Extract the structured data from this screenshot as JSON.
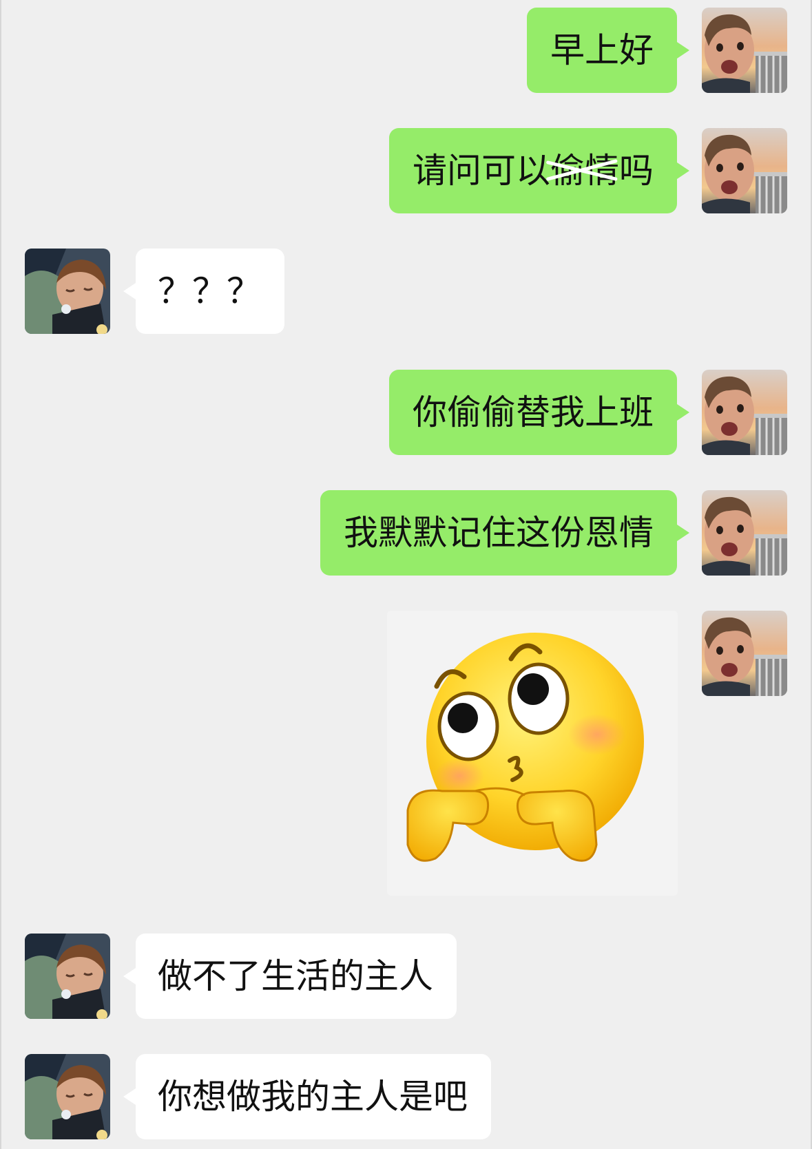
{
  "messages": [
    {
      "side": "right",
      "text": "早上好"
    },
    {
      "side": "right",
      "text": "请问可以偷情吗"
    },
    {
      "side": "left",
      "text": "？？？"
    },
    {
      "side": "right",
      "text": "你偷偷替我上班"
    },
    {
      "side": "right",
      "text": "我默默记住这份恩情"
    },
    {
      "side": "right",
      "type": "sticker",
      "sticker": "blushing-emoji-sticker"
    },
    {
      "side": "left",
      "text": "做不了生活的主人"
    },
    {
      "side": "left",
      "text": "你想做我的主人是吧"
    }
  ],
  "colors": {
    "background": "#efefef",
    "my_bubble": "#95ec69",
    "their_bubble": "#ffffff",
    "text": "#111111"
  },
  "icons": {
    "my_avatar": "sunset-child-avatar",
    "their_avatar": "sleeping-child-avatar"
  }
}
